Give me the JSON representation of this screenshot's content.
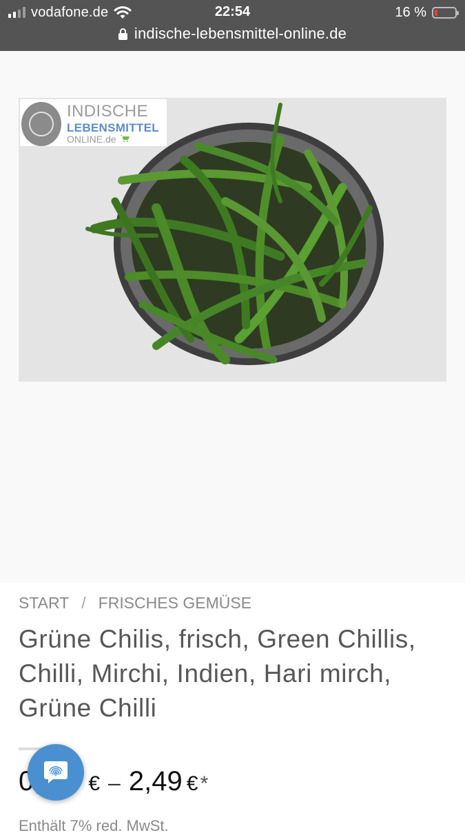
{
  "status_bar": {
    "carrier": "vodafone.de",
    "time": "22:54",
    "battery_percent_label": "16 %",
    "battery_level": 0.16,
    "signal_bars_active": 2,
    "signal_bars_total": 4
  },
  "url_bar": {
    "url": "indische-lebensmittel-online.de"
  },
  "gallery": {
    "logo": {
      "line1": "INDISCHE",
      "line2": "LEBENSMITTEL",
      "line3": "ONLINE.de"
    }
  },
  "breadcrumb": {
    "items": [
      "START",
      "FRISCHES GEMÜSE"
    ],
    "separator": "/"
  },
  "product": {
    "title": "Grüne Chilis, frisch, Green Chillis, Chilli, Mirchi, Indien, Hari mirch, Grüne Chilli",
    "price_from": "0,",
    "price_to": "2,49",
    "currency": "€",
    "range_separator": "–",
    "asterisk": "*",
    "tax_note": "Enthält 7% red. MwSt."
  },
  "colors": {
    "topbar": "#545454",
    "accent_blue": "#4a90d0",
    "battery_low": "#ff3b30",
    "chili_green": "#4f8a2a"
  },
  "icons": {
    "fab": "fingerprint-chat-icon",
    "lock": "lock-icon",
    "wifi": "wifi-icon"
  }
}
